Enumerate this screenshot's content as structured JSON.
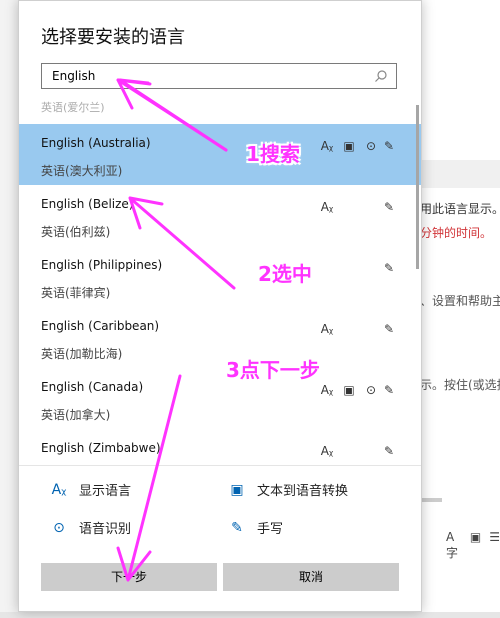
{
  "background": {
    "line1": "用此语言显示。",
    "line2": "分钟的时间。",
    "line3": "、设置和帮助主",
    "line4": "示。按住(或选择"
  },
  "dialog": {
    "title": "选择要安装的语言",
    "search": {
      "value": "English"
    },
    "partial_row": "英语(爱尔兰)",
    "languages": [
      {
        "name": "English (Australia)",
        "local": "英语(澳大利亚)",
        "selected": true
      },
      {
        "name": "English (Belize)",
        "local": "英语(伯利兹)",
        "selected": false
      },
      {
        "name": "English (Philippines)",
        "local": "英语(菲律宾)",
        "selected": false
      },
      {
        "name": "English (Caribbean)",
        "local": "英语(加勒比海)",
        "selected": false
      },
      {
        "name": "English (Canada)",
        "local": "英语(加拿大)",
        "selected": false
      },
      {
        "name": "English (Zimbabwe)",
        "local": "",
        "selected": false
      }
    ],
    "legend": {
      "display": "显示语言",
      "tts": "文本到语音转换",
      "speech": "语音识别",
      "handwriting": "手写"
    },
    "buttons": {
      "next": "下一步",
      "cancel": "取消"
    }
  },
  "annotations": {
    "step1": "1搜索",
    "step2": "2选中",
    "step3": "3点下一步",
    "color": "#ff33ff"
  },
  "icons": {
    "display": "display-language-icon",
    "tts": "text-to-speech-icon",
    "speech": "microphone-icon",
    "handwriting": "handwriting-icon",
    "search": "search-icon"
  },
  "colors": {
    "selected_row": "#99c9ef",
    "accent": "#0063b1",
    "button": "#cccccc"
  }
}
